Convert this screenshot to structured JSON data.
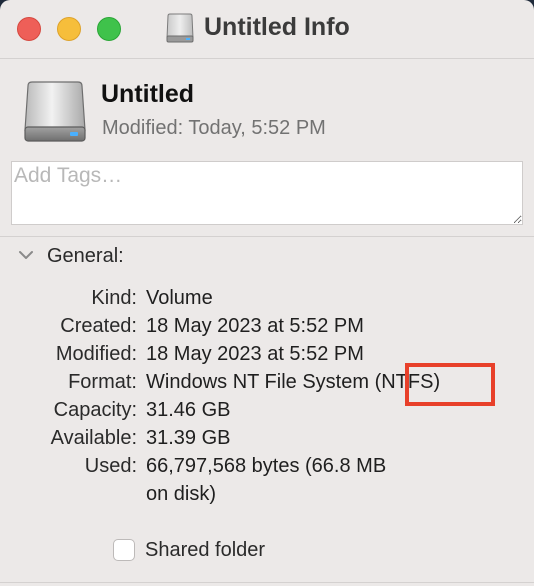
{
  "window": {
    "title": "Untitled Info",
    "controls": {
      "close_color": "#ee5f58",
      "minimize_color": "#f6be3b",
      "zoom_color": "#3fc24b"
    }
  },
  "header": {
    "icon": "external-drive-icon",
    "name": "Untitled",
    "modified_label": "Modified:",
    "modified_value": "Today, 5:52 PM"
  },
  "tags": {
    "placeholder": "Add Tags…",
    "value": ""
  },
  "general": {
    "label": "General:",
    "expanded": true,
    "rows": [
      {
        "key": "Kind:",
        "value": "Volume"
      },
      {
        "key": "Created:",
        "value": "18 May 2023 at 5:52 PM"
      },
      {
        "key": "Modified:",
        "value": "18 May 2023 at 5:52 PM"
      },
      {
        "key": "Format:",
        "value": "Windows NT File System (NTFS)"
      },
      {
        "key": "Capacity:",
        "value": "31.46 GB"
      },
      {
        "key": "Available:",
        "value": "31.39 GB"
      },
      {
        "key": "Used:",
        "value": "66,797,568 bytes (66.8 MB",
        "value_line2": "on disk)"
      }
    ],
    "shared_folder": {
      "label": "Shared folder",
      "checked": false
    }
  },
  "highlight": {
    "target": "(NTFS)",
    "color": "#e8402a"
  }
}
